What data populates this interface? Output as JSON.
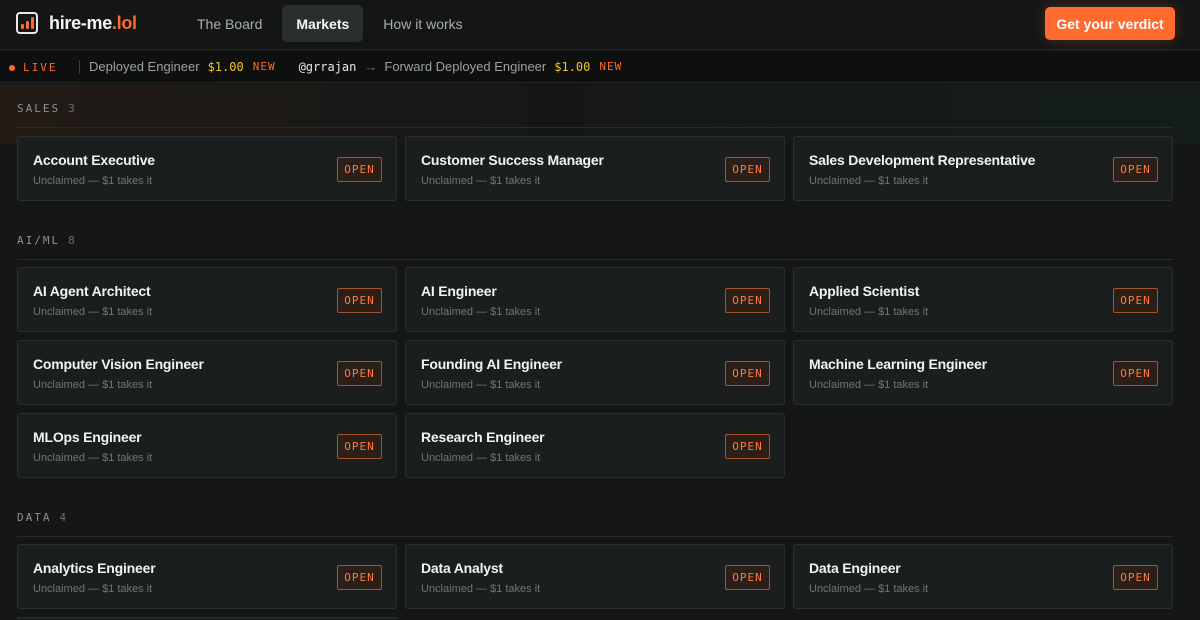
{
  "header": {
    "logo_name": "hire-me",
    "logo_tld": ".lol",
    "nav": [
      {
        "label": "The Board",
        "active": false
      },
      {
        "label": "Markets",
        "active": true
      },
      {
        "label": "How it works",
        "active": false
      }
    ],
    "cta_label": "Get your verdict"
  },
  "ticker": {
    "live_label": "LIVE",
    "items": [
      {
        "role": "Deployed Engineer",
        "price": "$1.00",
        "tag": "NEW"
      },
      {
        "user": "@grrajan",
        "arrow": "→",
        "role": "Forward Deployed Engineer",
        "price": "$1.00",
        "tag": "NEW"
      }
    ]
  },
  "sections": [
    {
      "name": "SALES",
      "count": "3",
      "cards": [
        {
          "title": "Account Executive",
          "status": "Unclaimed — $1 takes it",
          "badge": "OPEN"
        },
        {
          "title": "Customer Success Manager",
          "status": "Unclaimed — $1 takes it",
          "badge": "OPEN"
        },
        {
          "title": "Sales Development Representative",
          "status": "Unclaimed — $1 takes it",
          "badge": "OPEN"
        }
      ]
    },
    {
      "name": "AI/ML",
      "count": "8",
      "cards": [
        {
          "title": "AI Agent Architect",
          "status": "Unclaimed — $1 takes it",
          "badge": "OPEN"
        },
        {
          "title": "AI Engineer",
          "status": "Unclaimed — $1 takes it",
          "badge": "OPEN"
        },
        {
          "title": "Applied Scientist",
          "status": "Unclaimed — $1 takes it",
          "badge": "OPEN"
        },
        {
          "title": "Computer Vision Engineer",
          "status": "Unclaimed — $1 takes it",
          "badge": "OPEN"
        },
        {
          "title": "Founding AI Engineer",
          "status": "Unclaimed — $1 takes it",
          "badge": "OPEN"
        },
        {
          "title": "Machine Learning Engineer",
          "status": "Unclaimed — $1 takes it",
          "badge": "OPEN"
        },
        {
          "title": "MLOps Engineer",
          "status": "Unclaimed — $1 takes it",
          "badge": "OPEN"
        },
        {
          "title": "Research Engineer",
          "status": "Unclaimed — $1 takes it",
          "badge": "OPEN"
        }
      ]
    },
    {
      "name": "DATA",
      "count": "4",
      "cards": [
        {
          "title": "Analytics Engineer",
          "status": "Unclaimed — $1 takes it",
          "badge": "OPEN"
        },
        {
          "title": "Data Analyst",
          "status": "Unclaimed — $1 takes it",
          "badge": "OPEN"
        },
        {
          "title": "Data Engineer",
          "status": "Unclaimed — $1 takes it",
          "badge": "OPEN"
        }
      ]
    }
  ],
  "colors": {
    "accent": "#ff6b2e",
    "price": "#f0c52b",
    "background": "#151717",
    "card": "#1b1e1e"
  }
}
